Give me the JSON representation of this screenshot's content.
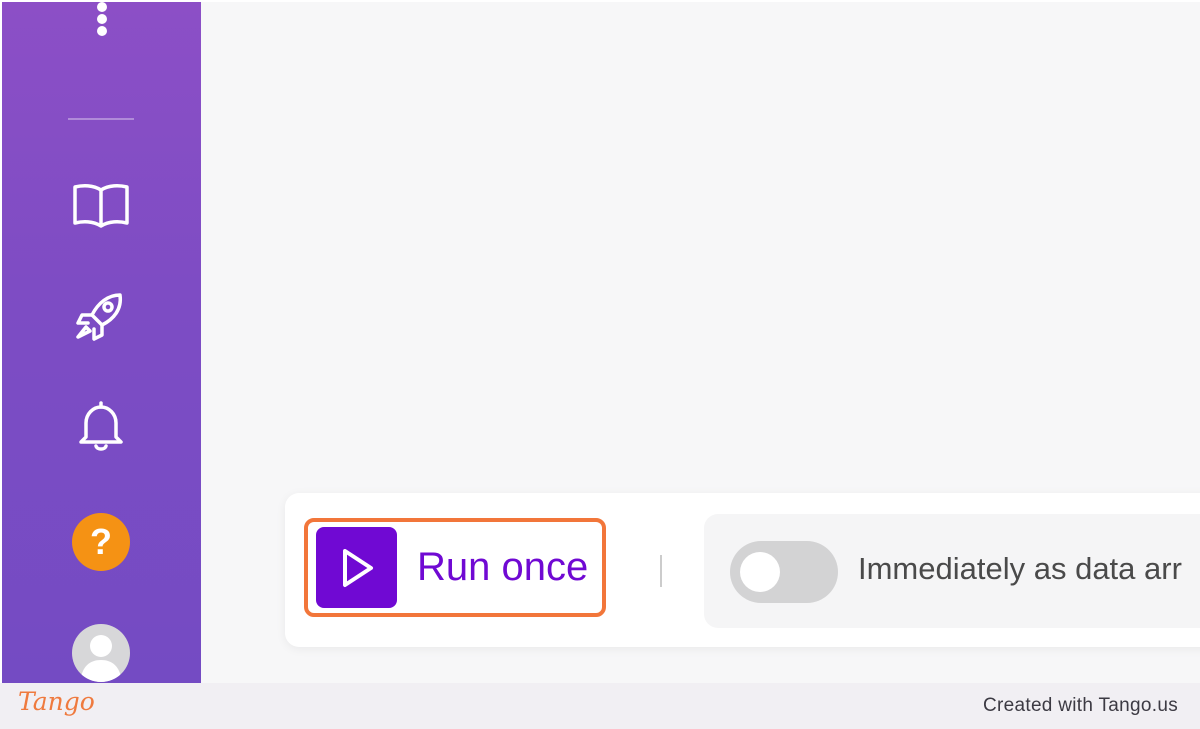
{
  "sidebar": {
    "items": [
      {
        "icon": "book-icon"
      },
      {
        "icon": "rocket-icon"
      },
      {
        "icon": "bell-icon"
      }
    ],
    "help_label": "?",
    "help_color": "#f59214",
    "avatar_icon": "user-avatar-icon"
  },
  "toolbar": {
    "run_once_label": "Run once",
    "trigger_label": "Immediately as data arr",
    "toggle_on": false,
    "accent_color": "#7009d3",
    "highlight_color": "#f2763a"
  },
  "footer": {
    "logo": "Tango",
    "credit": "Created with Tango.us"
  }
}
